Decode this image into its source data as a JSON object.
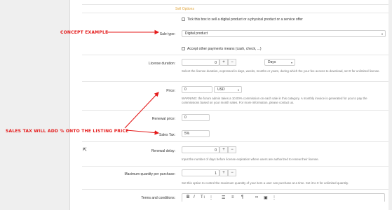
{
  "section_title": "Sell Options",
  "checkbox_sell": "Tick this box to sell a digital product or a physical product or a service offer",
  "sale_type": {
    "label": "Sale type:",
    "value": "Digital product"
  },
  "accept_other": "Accept other payments means (cash, check, ...)",
  "license_duration": {
    "label": "License duration:",
    "value": "0",
    "unit": "Days",
    "help": "Select the license duration, expressed in days, weeks, months or years, during which the your fee access to download, set 0 for unlimited license."
  },
  "price": {
    "label": "Price:",
    "value": "0",
    "currency": "USD",
    "help": "WARNING: the forum admin takes a 10.00% commission on each sale in this category. A monthly invoice is generated for you to pay the commissions based on your month sales. For more information, please contact us."
  },
  "renewal_price": {
    "label": "Renewal price:",
    "value": "0"
  },
  "sales_tax": {
    "label": "Sales Tax:",
    "value": "5%"
  },
  "renewal_delay": {
    "label": "Renewal delay:",
    "value": "0",
    "help": "Input the number of days before license expiration where users are authorized to renew their license."
  },
  "max_quantity": {
    "label": "Maximum quantity per purchase:",
    "value": "1",
    "help": "Set this option to control the maximum quantity of your item a user can purchase at a time. Set it to 0 for unlimited quantity."
  },
  "terms": {
    "label": "Terms and conditions:"
  },
  "annotations": {
    "concept": "CONCEPT EXAMPLE",
    "sales_tax_note": "SALES TAX WILL ADD % ONTO THE LISTING PRICE"
  },
  "colors": {
    "accent": "#e0a43a",
    "annotation": "#e41b1b"
  }
}
